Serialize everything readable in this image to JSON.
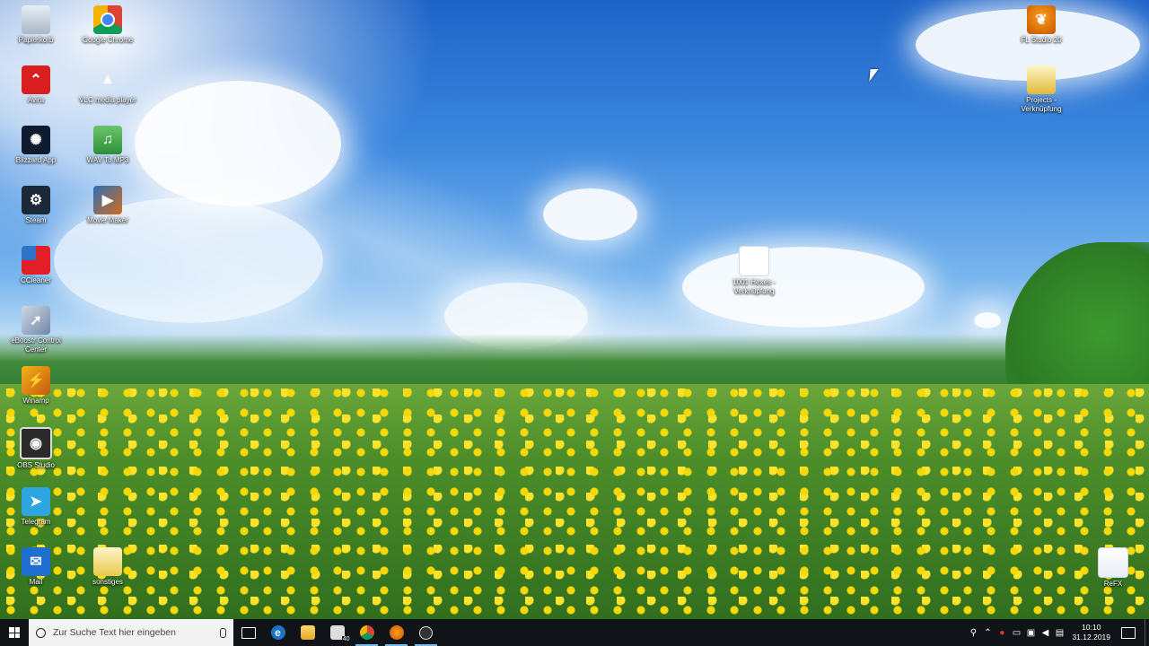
{
  "desktop": {
    "icons_left": [
      {
        "label": "Papierkorb",
        "icon": "recycle-bin-icon"
      },
      {
        "label": "Google Chrome",
        "icon": "chrome-icon"
      },
      {
        "label": "Avira",
        "icon": "avira-icon"
      },
      {
        "label": "VLC media player",
        "icon": "vlc-icon"
      },
      {
        "label": "Blizzard App",
        "icon": "blizzard-icon"
      },
      {
        "label": "WAV To MP3",
        "icon": "wav-to-mp3-icon"
      },
      {
        "label": "Steam",
        "icon": "steam-icon"
      },
      {
        "label": "Movie Maker",
        "icon": "movie-maker-icon"
      },
      {
        "label": "CCleaner",
        "icon": "ccleaner-icon"
      },
      {
        "label": "eBoostr Control Center",
        "icon": "eboostr-icon"
      },
      {
        "label": "Winamp",
        "icon": "winamp-icon"
      },
      {
        "label": "OBS Studio",
        "icon": "obs-icon"
      },
      {
        "label": "Telegram",
        "icon": "telegram-icon"
      },
      {
        "label": "Mail",
        "icon": "mail-icon"
      },
      {
        "label": "sonstiges",
        "icon": "folder-icon"
      }
    ],
    "icons_right": [
      {
        "label": "FL Studio 20",
        "icon": "fl-studio-icon"
      },
      {
        "label": "Projects - Verknüpfung",
        "icon": "projects-shortcut-icon"
      },
      {
        "label": "ReFX",
        "icon": "refx-file-icon"
      }
    ],
    "icons_middle": [
      {
        "label": "1001 Hexes - Verknüpfung",
        "icon": "music-file-shortcut-icon"
      }
    ]
  },
  "taskbar": {
    "search_placeholder": "Zur Suche Text hier eingeben",
    "pinned": [
      {
        "name": "task-view",
        "icon": "task-view-icon"
      },
      {
        "name": "edge",
        "icon": "edge-icon"
      },
      {
        "name": "file-explorer",
        "icon": "folder-icon"
      },
      {
        "name": "mail",
        "icon": "mail-icon",
        "badge": "40"
      },
      {
        "name": "chrome",
        "icon": "chrome-icon"
      },
      {
        "name": "fl-studio",
        "icon": "fl-studio-icon"
      },
      {
        "name": "obs",
        "icon": "obs-icon"
      }
    ],
    "mail_badge": "40",
    "clock": {
      "time": "10:10",
      "date": "31.12.2019"
    }
  },
  "colors": {
    "taskbar": "#101418",
    "accent": "#76b9ed"
  }
}
